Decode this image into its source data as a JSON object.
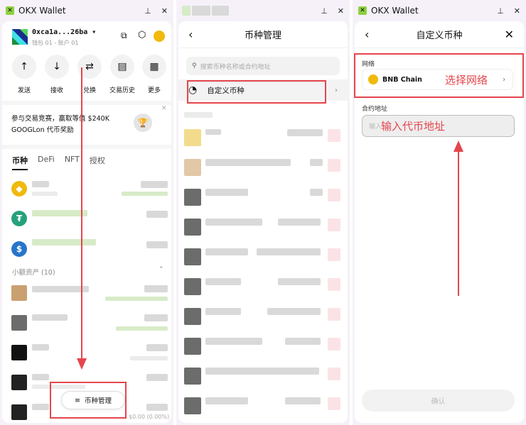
{
  "panel1": {
    "title": "OKX Wallet",
    "address": "0xca1a...26ba",
    "account": "钱包 01 - 账户 01",
    "actions": [
      {
        "label": "发送",
        "icon": "arrow-up-icon"
      },
      {
        "label": "接收",
        "icon": "arrow-down-icon"
      },
      {
        "label": "兑换",
        "icon": "swap-icon"
      },
      {
        "label": "交易历史",
        "icon": "history-icon"
      },
      {
        "label": "更多",
        "icon": "grid-icon"
      }
    ],
    "banner": "参与交易竞赛，赢取等值 $240K GOOGLon 代币奖励",
    "tabs": [
      "币种",
      "DeFi",
      "NFT",
      "授权"
    ],
    "small_assets": "小额资产 (10)",
    "last_value": "$0.00 (0.00%)",
    "manage_button": "币种管理"
  },
  "panel2": {
    "title": "币种管理",
    "search_placeholder": "搜索币种名称或合约地址",
    "custom_token": "自定义币种"
  },
  "panel3": {
    "window_title": "OKX Wallet",
    "title": "自定义币种",
    "network_label": "网络",
    "network": "BNB Chain",
    "annotation_network": "选择网络",
    "contract_label": "合约地址",
    "contract_placeholder": "输入代币地址",
    "annotation_contract": "输入代币地址",
    "confirm": "确认"
  },
  "colors": {
    "annotation": "#e5454d",
    "bnb": "#f0b90b",
    "usdt": "#26a17b",
    "usdc": "#2775ca"
  }
}
